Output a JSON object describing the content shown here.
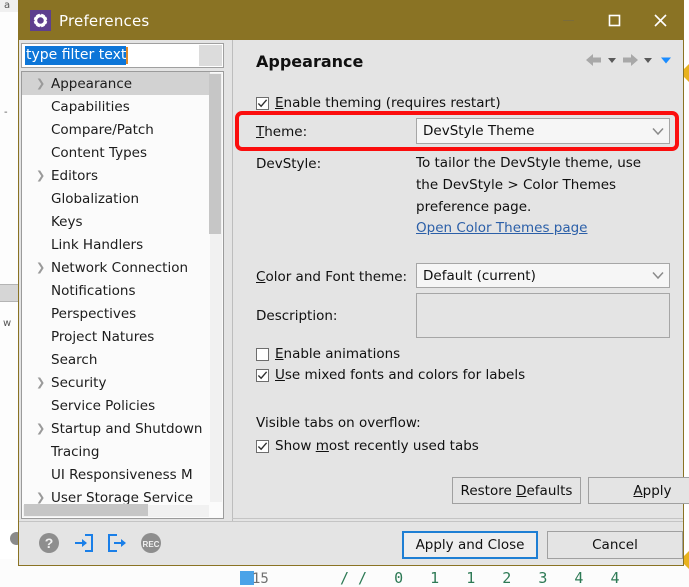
{
  "window": {
    "title": "Preferences",
    "icon": "gear-icon",
    "titlebar_color": "#8a7324",
    "controls": {
      "minimize": "minimize-icon",
      "maximize": "maximize-icon",
      "close": "close-icon"
    }
  },
  "filter": {
    "value": "type filter text",
    "placeholder": "type filter text"
  },
  "tree": {
    "items": [
      {
        "label": "Appearance",
        "expandable": true,
        "selected": true
      },
      {
        "label": "Capabilities",
        "expandable": false,
        "selected": false
      },
      {
        "label": "Compare/Patch",
        "expandable": false,
        "selected": false
      },
      {
        "label": "Content Types",
        "expandable": false,
        "selected": false
      },
      {
        "label": "Editors",
        "expandable": true,
        "selected": false
      },
      {
        "label": "Globalization",
        "expandable": false,
        "selected": false
      },
      {
        "label": "Keys",
        "expandable": false,
        "selected": false
      },
      {
        "label": "Link Handlers",
        "expandable": false,
        "selected": false
      },
      {
        "label": "Network Connection",
        "expandable": true,
        "selected": false
      },
      {
        "label": "Notifications",
        "expandable": false,
        "selected": false
      },
      {
        "label": "Perspectives",
        "expandable": false,
        "selected": false
      },
      {
        "label": "Project Natures",
        "expandable": false,
        "selected": false
      },
      {
        "label": "Search",
        "expandable": false,
        "selected": false
      },
      {
        "label": "Security",
        "expandable": true,
        "selected": false
      },
      {
        "label": "Service Policies",
        "expandable": false,
        "selected": false
      },
      {
        "label": "Startup and Shutdown",
        "expandable": true,
        "selected": false
      },
      {
        "label": "Tracing",
        "expandable": false,
        "selected": false
      },
      {
        "label": "UI Responsiveness M",
        "expandable": false,
        "selected": false
      },
      {
        "label": "User Storage Service",
        "expandable": true,
        "selected": false
      }
    ]
  },
  "page": {
    "title": "Appearance",
    "nav": {
      "back": "back-arrow-icon",
      "back_menu": "chevron-down-icon",
      "forward": "forward-arrow-icon",
      "forward_menu": "chevron-down-icon",
      "view_menu": "blue-chevron-down-icon"
    },
    "enable_theming": {
      "label": "Enable theming (requires restart)",
      "checked": true
    },
    "theme": {
      "label": "Theme:",
      "value": "DevStyle Theme",
      "highlighted": true,
      "highlight_color": "#fb0d0d"
    },
    "devstyle": {
      "label": "DevStyle:",
      "line1": "To tailor the DevStyle theme, use",
      "line2": "the DevStyle > Color Themes",
      "line3": "preference page.",
      "link": "Open Color Themes page"
    },
    "color_font_theme": {
      "label": "Color and Font theme:",
      "value": "Default (current)"
    },
    "description": {
      "label": "Description:",
      "value": ""
    },
    "enable_animations": {
      "label": "Enable animations",
      "checked": false
    },
    "mixed_fonts": {
      "label": "Use mixed fonts and colors for labels",
      "checked": true
    },
    "visible_tabs": {
      "label": "Visible tabs on overflow:",
      "show_mru": {
        "label": "Show most recently used tabs",
        "checked": true
      }
    },
    "buttons": {
      "restore_defaults": "Restore Defaults",
      "apply": "Apply"
    }
  },
  "footer": {
    "icons": [
      {
        "name": "help-icon",
        "glyph": "?"
      },
      {
        "name": "import-icon",
        "glyph": "import"
      },
      {
        "name": "export-icon",
        "glyph": "export"
      },
      {
        "name": "rec-icon",
        "glyph": "REC"
      }
    ],
    "apply_and_close": "Apply and Close",
    "cancel": "Cancel"
  },
  "background": {
    "left_labels": [
      "a",
      "-",
      "w"
    ],
    "green_row": "// 0 1 1 2 3 4 4",
    "line_number": "15"
  }
}
